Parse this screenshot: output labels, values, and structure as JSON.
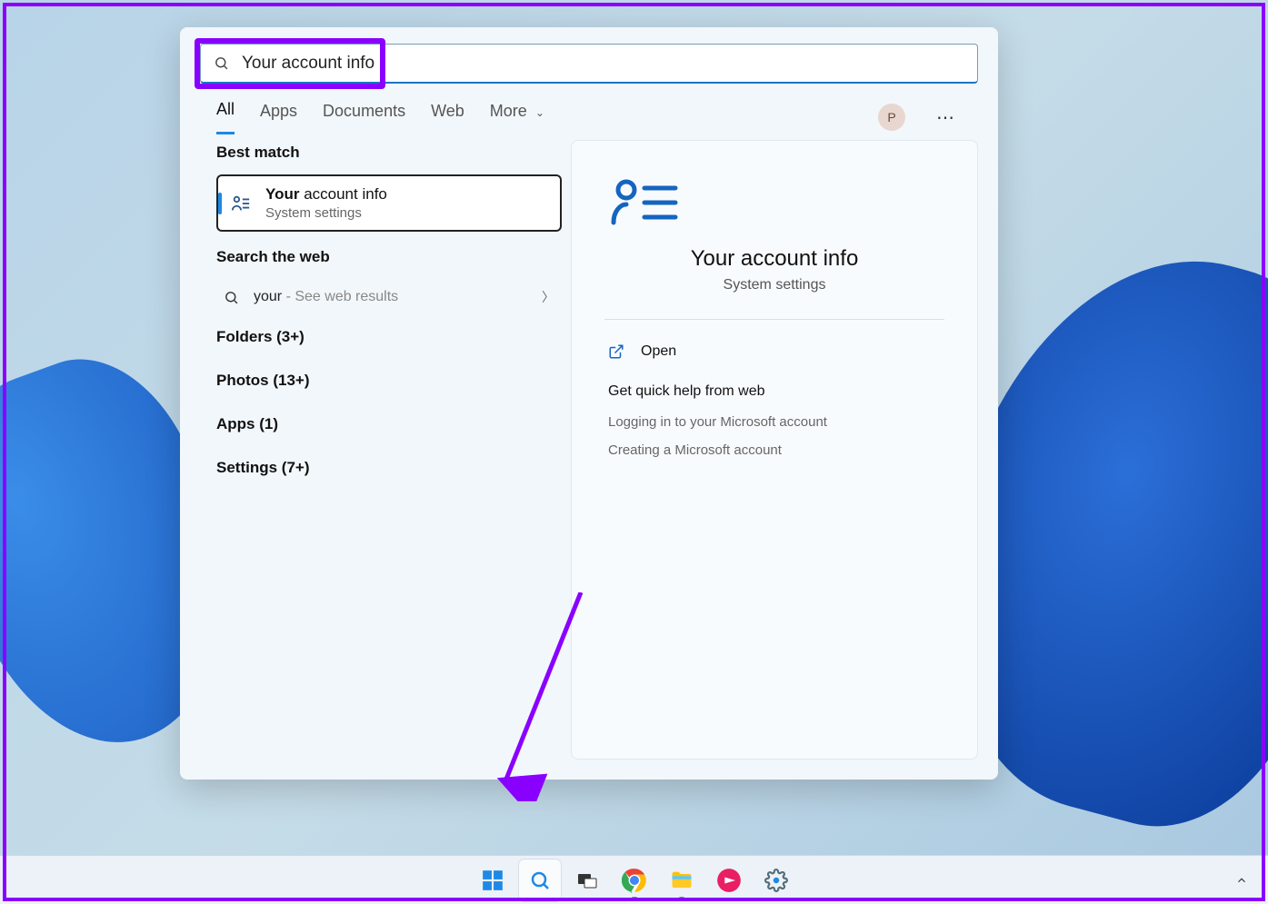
{
  "search": {
    "value": "Your account info"
  },
  "tabs": {
    "all": "All",
    "apps": "Apps",
    "documents": "Documents",
    "web": "Web",
    "more": "More"
  },
  "user_initial": "P",
  "left": {
    "best_match_head": "Best match",
    "best_match": {
      "bold": "Your",
      "rest": " account info",
      "sub": "System settings"
    },
    "search_web_head": "Search the web",
    "web_item": {
      "term": "your",
      "suffix": " - See web results"
    },
    "categories": {
      "folders": "Folders (3+)",
      "photos": "Photos (13+)",
      "apps": "Apps (1)",
      "settings": "Settings (7+)"
    }
  },
  "detail": {
    "title": "Your account info",
    "sub": "System settings",
    "open": "Open",
    "help_head": "Get quick help from web",
    "help1": "Logging in to your Microsoft account",
    "help2": "Creating a Microsoft account"
  },
  "taskbar": {
    "start": "start",
    "search": "search",
    "taskview": "task-view",
    "chrome": "chrome",
    "explorer": "file-explorer",
    "app5": "app",
    "settings": "settings"
  }
}
